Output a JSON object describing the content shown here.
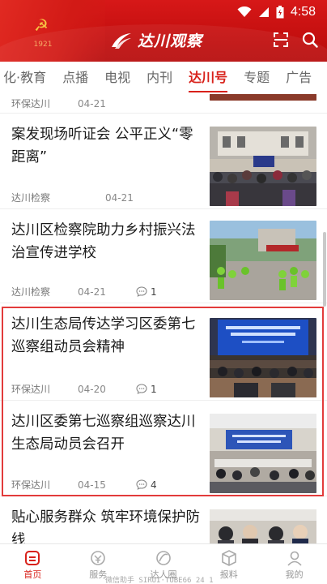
{
  "status_bar": {
    "time": "4:58"
  },
  "header": {
    "emblem_text": "1921",
    "logo_text": "达川观察"
  },
  "tabs": [
    "化·教育",
    "点播",
    "电视",
    "内刊",
    "达川号",
    "专题",
    "广告"
  ],
  "active_tab": "达川号",
  "news": [
    {
      "title": "",
      "source": "环保达川",
      "date": "04-21",
      "comments": ""
    },
    {
      "title": "案发现场听证会 公平正义“零距离”",
      "source": "达川检察",
      "date": "04-21",
      "comments": ""
    },
    {
      "title": "达川区检察院助力乡村振兴法治宣传进学校",
      "source": "达川检察",
      "date": "04-21",
      "comments": "1"
    },
    {
      "title": "达川生态局传达学习区委第七巡察组动员会精神",
      "source": "环保达川",
      "date": "04-20",
      "comments": "1"
    },
    {
      "title": "达川区委第七巡察组巡察达川生态局动员会召开",
      "source": "环保达川",
      "date": "04-15",
      "comments": "4"
    },
    {
      "title": "贴心服务群众 筑牢环境保护防线",
      "source": "",
      "date": "",
      "comments": ""
    }
  ],
  "bottom_nav": {
    "home": "首页",
    "service": "服务",
    "circle": "达人圈",
    "report": "报料",
    "mine": "我的"
  },
  "watermark": "微信助手 SIRUI·TUBE66 24 1",
  "colors": {
    "brand_red": "#d8211a",
    "header_red": "#c40f0f",
    "highlight": "#e23b3b"
  }
}
